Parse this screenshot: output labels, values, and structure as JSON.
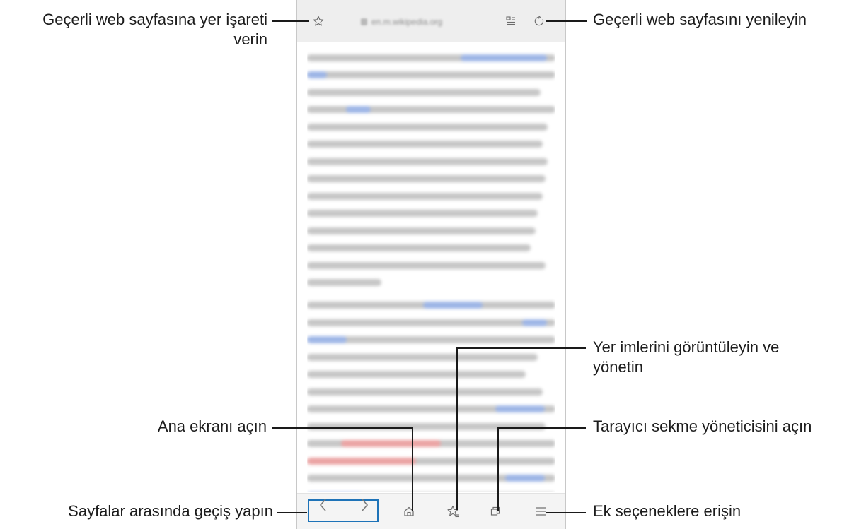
{
  "browser": {
    "url_text": "en.m.wikipedia.org",
    "icons": {
      "bookmark_add": "star-outline-icon",
      "reader_mode": "reader-mode-icon",
      "refresh": "refresh-icon",
      "back": "chevron-left-icon",
      "forward": "chevron-right-icon",
      "home": "home-icon",
      "bookmarks": "bookmarks-star-icon",
      "tabs": "tabs-icon",
      "menu": "hamburger-menu-icon"
    }
  },
  "callouts": {
    "bookmark_line1": "Geçerli web sayfasına yer işareti",
    "bookmark_line2": "verin",
    "refresh": "Geçerli web sayfasını yenileyin",
    "bookmarks_line1": "Yer imlerini görüntüleyin ve",
    "bookmarks_line2": "yönetin",
    "home": "Ana ekranı açın",
    "tabs": "Tarayıcı sekme yöneticisini açın",
    "navigate": "Sayfalar arasında geçiş yapın",
    "more": "Ek seçeneklere erişin"
  },
  "colors": {
    "highlight": "#1e73b8",
    "link": "#9db5e6",
    "red_link": "#eba3a3",
    "text_blur": "#c6c6c6"
  }
}
